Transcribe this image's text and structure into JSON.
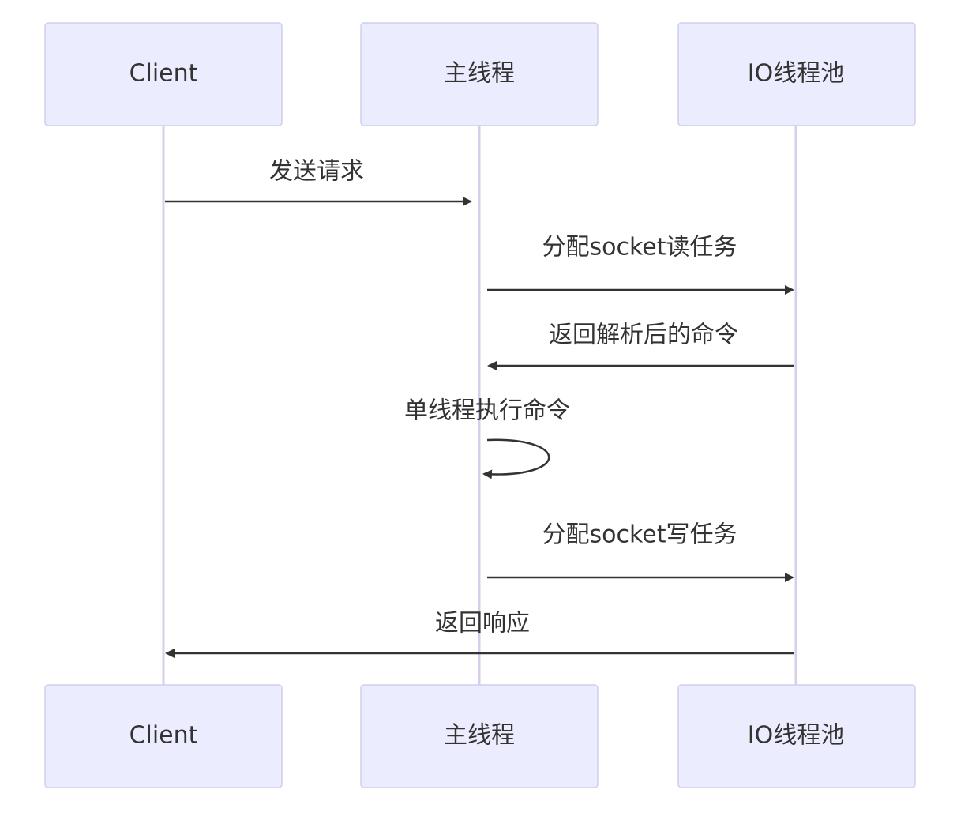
{
  "participants": [
    {
      "id": "client",
      "label": "Client"
    },
    {
      "id": "main",
      "label": "主线程"
    },
    {
      "id": "io",
      "label": "IO线程池"
    }
  ],
  "messages": [
    {
      "from": "client",
      "to": "main",
      "label": "发送请求"
    },
    {
      "from": "main",
      "to": "io",
      "label": "分配socket读任务"
    },
    {
      "from": "io",
      "to": "main",
      "label": "返回解析后的命令"
    },
    {
      "from": "main",
      "to": "main",
      "label": "单线程执行命令"
    },
    {
      "from": "main",
      "to": "io",
      "label": "分配socket写任务"
    },
    {
      "from": "io",
      "to": "client",
      "label": "返回响应"
    }
  ],
  "colors": {
    "actor_fill": "#ECECFF",
    "actor_border": "#CFCFEF",
    "lifeline": "#D4D0EC",
    "arrow": "#333333",
    "text": "#333333"
  }
}
